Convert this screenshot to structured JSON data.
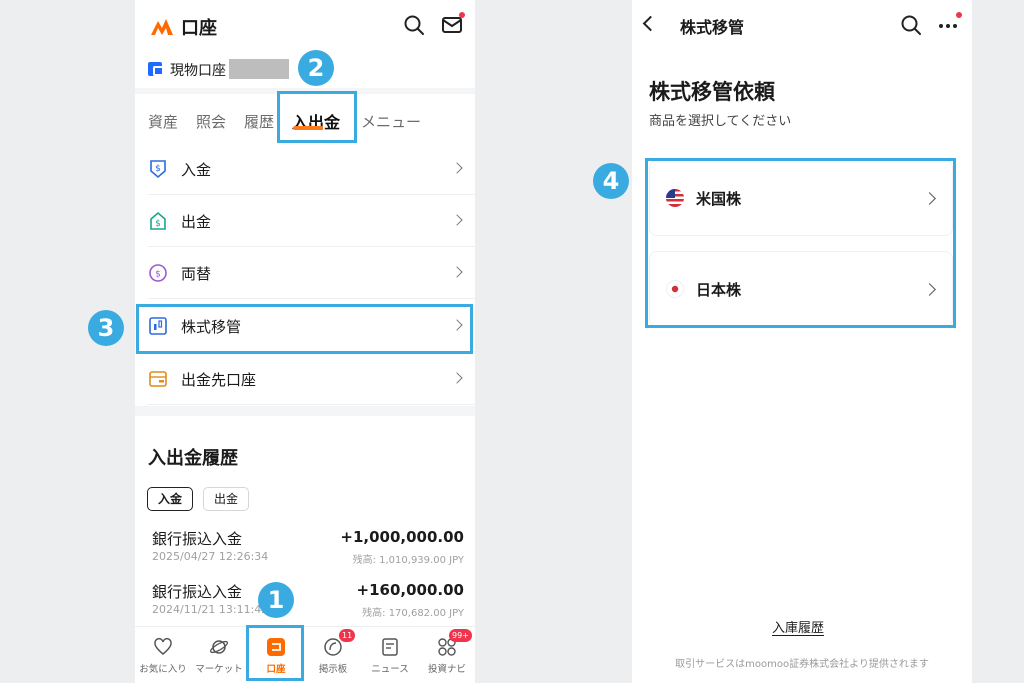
{
  "left": {
    "header": {
      "title": "口座"
    },
    "account": {
      "label": "現物口座"
    },
    "tabs": [
      {
        "label": "資産"
      },
      {
        "label": "照会"
      },
      {
        "label": "履歴"
      },
      {
        "label": "入出金"
      },
      {
        "label": "メニュー"
      }
    ],
    "menu": [
      {
        "label": "入金",
        "icon": "deposit-icon"
      },
      {
        "label": "出金",
        "icon": "withdraw-icon"
      },
      {
        "label": "両替",
        "icon": "exchange-icon"
      },
      {
        "label": "株式移管",
        "icon": "stock-transfer-icon"
      },
      {
        "label": "出金先口座",
        "icon": "bank-account-icon"
      }
    ],
    "history": {
      "title": "入出金履歴",
      "filters": [
        "入金",
        "出金"
      ],
      "items": [
        {
          "title": "銀行振込入金",
          "date": "2025/04/27 12:26:34",
          "amount": "+1,000,000.00",
          "balance": "残高: 1,010,939.00 JPY"
        },
        {
          "title": "銀行振込入金",
          "date": "2024/11/21 13:11:42",
          "amount": "+160,000.00",
          "balance": "残高: 170,682.00 JPY"
        }
      ]
    },
    "nav": [
      {
        "label": "お気に入り"
      },
      {
        "label": "マーケット"
      },
      {
        "label": "口座"
      },
      {
        "label": "掲示板",
        "badge": "11"
      },
      {
        "label": "ニュース"
      },
      {
        "label": "投資ナビ",
        "badge": "99+"
      }
    ]
  },
  "right": {
    "header": {
      "title": "株式移管"
    },
    "heading": "株式移管依頼",
    "subtitle": "商品を選択してください",
    "options": [
      {
        "label": "米国株"
      },
      {
        "label": "日本株"
      }
    ],
    "link": "入庫履歴",
    "footer": "取引サービスはmoomoo証券株式会社より提供されます"
  },
  "annotations": [
    "1",
    "2",
    "3",
    "4"
  ],
  "colors": {
    "accent": "#ff6a00",
    "highlight": "#3aabe0",
    "badge": "#f0344c"
  }
}
